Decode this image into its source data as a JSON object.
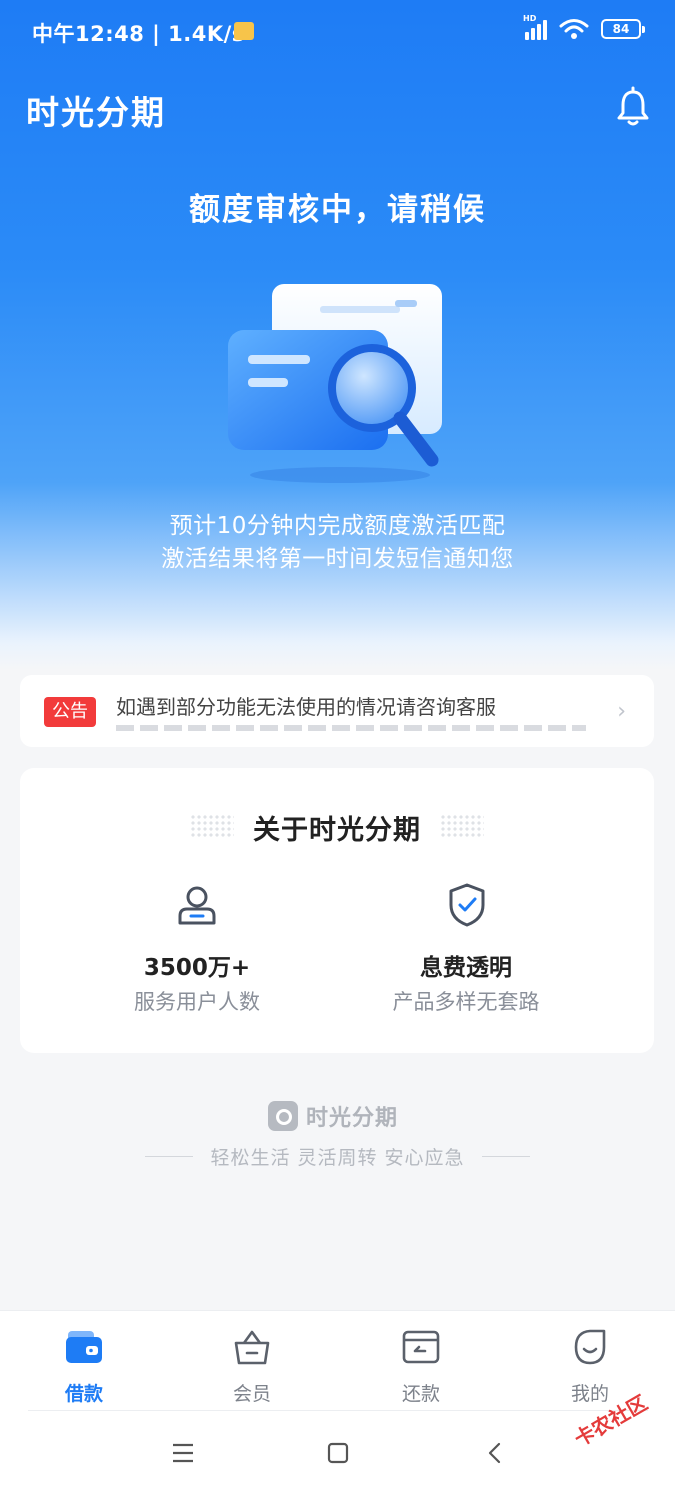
{
  "status_bar": {
    "time": "中午12:48 | 1.4K/s",
    "signal_label": "HD",
    "battery": "84"
  },
  "header": {
    "app_title": "时光分期",
    "bell_icon": "bell-icon"
  },
  "hero": {
    "headline": "额度审核中，请稍候",
    "illustration_icon": "document-search-icon",
    "desc_line1": "预计10分钟内完成额度激活匹配",
    "desc_line2": "激活结果将第一时间发短信通知您"
  },
  "notice": {
    "badge": "公告",
    "text": "如遇到部分功能无法使用的情况请咨询客服",
    "chevron_icon": "chevron-right-icon"
  },
  "about": {
    "title": "关于时光分期",
    "stats": [
      {
        "icon": "user-icon",
        "value": "3500万+",
        "label": "服务用户人数"
      },
      {
        "icon": "shield-check-icon",
        "value": "息费透明",
        "label": "产品多样无套路"
      }
    ]
  },
  "footer": {
    "brand_name": "时光分期",
    "slogan": "轻松生活 灵活周转 安心应急"
  },
  "tabs": [
    {
      "label": "借款",
      "icon": "wallet-icon",
      "active": true
    },
    {
      "label": "会员",
      "icon": "basket-icon",
      "active": false
    },
    {
      "label": "还款",
      "icon": "repay-card-icon",
      "active": false
    },
    {
      "label": "我的",
      "icon": "smile-face-icon",
      "active": false
    }
  ],
  "watermark": "卡农社区",
  "colors": {
    "primary": "#1e7cf5",
    "notice_badge": "#f23b3b",
    "background": "#f5f6f8"
  }
}
